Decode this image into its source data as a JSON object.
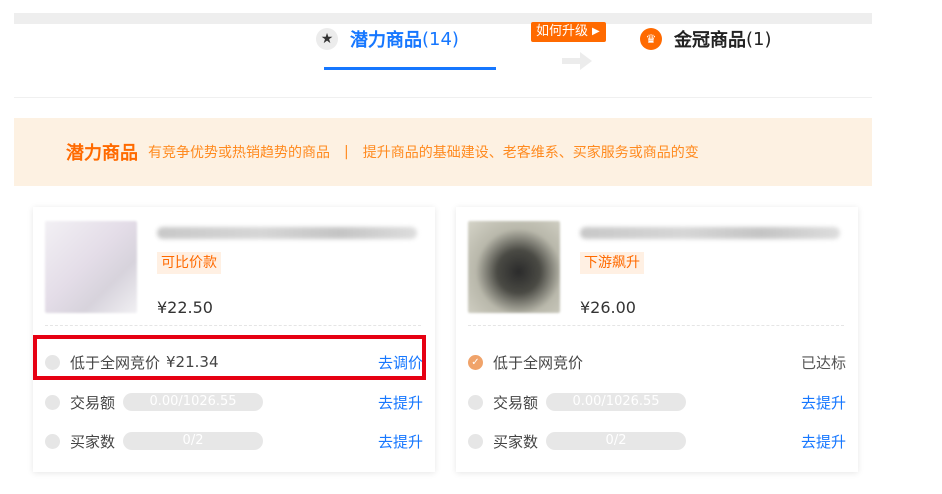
{
  "tabs": {
    "potential": {
      "label": "潜力商品",
      "count": "(14)",
      "icon": "star-icon"
    },
    "crown": {
      "label": "金冠商品",
      "count": "(1)",
      "icon": "crown-icon"
    },
    "upgrade_link": "如何升级"
  },
  "banner": {
    "title": "潜力商品",
    "desc1": "有竞争优势或热销趋势的商品",
    "separator": "|",
    "desc2": "提升商品的基础建设、老客维系、买家服务或商品的变"
  },
  "cards": [
    {
      "tag": "可比价款",
      "price": "¥22.50",
      "rows": [
        {
          "label": "低于全网竞价",
          "value": "¥21.34",
          "action": "去调价",
          "done": false
        },
        {
          "label": "交易额",
          "pill": "0.00/1026.55",
          "action": "去提升",
          "done": false
        },
        {
          "label": "买家数",
          "pill": "0/2",
          "action": "去提升",
          "done": false
        }
      ]
    },
    {
      "tag": "下游飙升",
      "price": "¥26.00",
      "rows": [
        {
          "label": "低于全网竞价",
          "status": "已达标",
          "done": true
        },
        {
          "label": "交易额",
          "pill": "0.00/1026.55",
          "action": "去提升",
          "done": false
        },
        {
          "label": "买家数",
          "pill": "0/2",
          "action": "去提升",
          "done": false
        }
      ]
    }
  ],
  "colors": {
    "accent": "#1677ff",
    "orange": "#ff6a00",
    "highlight": "#e60012",
    "banner_bg": "#fdf1e2"
  }
}
